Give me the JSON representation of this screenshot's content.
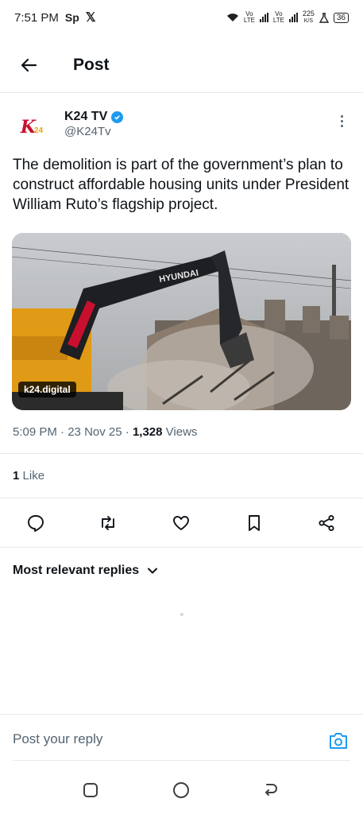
{
  "status_bar": {
    "time": "7:51 PM",
    "app_badge": "Sp",
    "x_logo": "𝕏",
    "net1": "Vo LTE",
    "net2": "Vo LTE",
    "speed": "225",
    "speed_unit": "K/S",
    "battery": "36"
  },
  "header": {
    "title": "Post"
  },
  "author": {
    "name": "K24 TV",
    "handle": "@K24Tv",
    "avatar_letter": "K",
    "avatar_suffix": "24"
  },
  "tweet": {
    "text": "The demolition is part of the government’s plan to construct affordable housing units under President William Ruto’s flagship project.",
    "media_label": "k24.digital",
    "media_excavator_brand": "HYUNDAI",
    "time": "5:09 PM",
    "date": "23 Nov 25",
    "views_count": "1,328",
    "views_label": "Views",
    "likes_count": "1",
    "likes_label": "Like"
  },
  "actions": [
    "reply-icon",
    "retweet-icon",
    "like-icon",
    "bookmark-icon",
    "share-icon"
  ],
  "replies": {
    "sort_label": "Most relevant replies"
  },
  "reply_bar": {
    "placeholder": "Post your reply"
  },
  "colors": {
    "accent": "#1d9bf0",
    "text": "#0f1419",
    "muted": "#536471"
  }
}
